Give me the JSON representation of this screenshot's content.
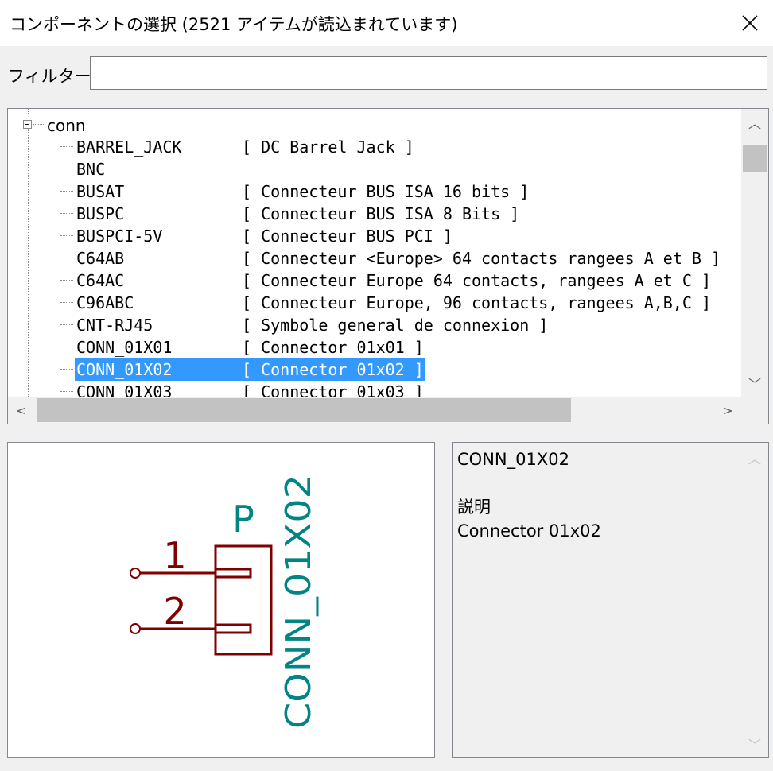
{
  "window": {
    "title": "コンポーネントの選択 (2521 アイテムが読込まれています)",
    "close_icon": "close-icon"
  },
  "filter": {
    "label": "フィルター:",
    "value": "",
    "placeholder": ""
  },
  "tree": {
    "root_label": "conn",
    "items": [
      {
        "name": "BARREL_JACK",
        "desc": "[ DC Barrel Jack ]"
      },
      {
        "name": "BNC",
        "desc": ""
      },
      {
        "name": "BUSAT",
        "desc": "[ Connecteur BUS ISA 16 bits ]"
      },
      {
        "name": "BUSPC",
        "desc": "[ Connecteur BUS ISA 8 Bits ]"
      },
      {
        "name": "BUSPCI-5V",
        "desc": "[ Connecteur BUS PCI ]"
      },
      {
        "name": "C64AB",
        "desc": "[ Connecteur <Europe> 64 contacts rangees A et B ]"
      },
      {
        "name": "C64AC",
        "desc": "[ Connecteur Europe 64 contacts, rangees A et C ]"
      },
      {
        "name": "C96ABC",
        "desc": "[ Connecteur Europe, 96 contacts, rangees A,B,C ]"
      },
      {
        "name": "CNT-RJ45",
        "desc": "[ Symbole general de connexion ]"
      },
      {
        "name": "CONN_01X01",
        "desc": "[ Connector 01x01 ]"
      },
      {
        "name": "CONN_01X02",
        "desc": "[ Connector 01x02 ]",
        "selected": true
      },
      {
        "name": "CONN_01X03",
        "desc": "[ Connector 01x03 ]"
      }
    ]
  },
  "scroll_glyphs": {
    "up": "︿",
    "down": "﹀",
    "left": "<",
    "right": ">"
  },
  "preview": {
    "ref": "P",
    "value": "CONN_01X02",
    "pins": [
      "1",
      "2"
    ],
    "body_color": "#800000",
    "text_color": "#008484"
  },
  "info": {
    "name": "CONN_01X02",
    "desc_heading": "説明",
    "desc": "Connector 01x02"
  },
  "colors": {
    "selection": "#3399ff"
  }
}
